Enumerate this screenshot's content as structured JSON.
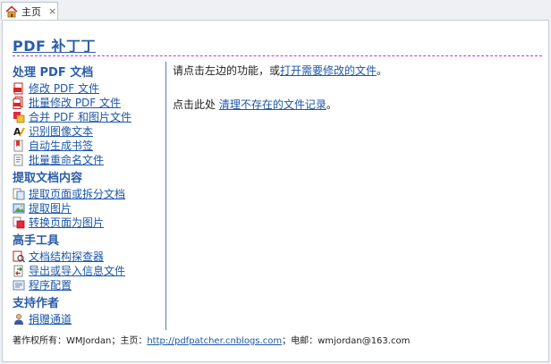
{
  "tab": {
    "label": "主页",
    "close": "×"
  },
  "title": "PDF 补丁丁",
  "sections": [
    {
      "heading": "处理 PDF 文档",
      "items": [
        {
          "label": "修改 PDF 文件",
          "icon": "pdf-edit-icon"
        },
        {
          "label": "批量修改 PDF 文件",
          "icon": "pdf-batch-icon"
        },
        {
          "label": "合并 PDF 和图片文件",
          "icon": "merge-icon"
        },
        {
          "label": "识别图像文本",
          "icon": "ocr-icon"
        },
        {
          "label": "自动生成书签",
          "icon": "bookmark-icon"
        },
        {
          "label": "批量重命名文件",
          "icon": "rename-icon"
        }
      ]
    },
    {
      "heading": "提取文档内容",
      "items": [
        {
          "label": "提取页面或拆分文档",
          "icon": "extract-pages-icon"
        },
        {
          "label": "提取图片",
          "icon": "extract-images-icon"
        },
        {
          "label": "转换页面为图片",
          "icon": "render-pages-icon"
        }
      ]
    },
    {
      "heading": "高手工具",
      "items": [
        {
          "label": "文档结构探查器",
          "icon": "inspector-icon"
        },
        {
          "label": "导出或导入信息文件",
          "icon": "export-import-icon"
        },
        {
          "label": "程序配置",
          "icon": "config-icon"
        }
      ]
    },
    {
      "heading": "支持作者",
      "items": [
        {
          "label": "捐赠通道",
          "icon": "donate-person-icon"
        }
      ]
    }
  ],
  "main": {
    "line1_prefix": "请点击左边的功能，或",
    "line1_link": "打开需要修改的文件",
    "line1_suffix": "。",
    "line2_prefix": "点击此处 ",
    "line2_link": "清理不存在的文件记录",
    "line2_suffix": "。"
  },
  "footer": {
    "prefix": "著作权所有：WMJordan；主页：",
    "link": "http://pdfpatcher.cnblogs.com",
    "suffix": "；电邮：wmjordan@163.com"
  },
  "colors": {
    "accent": "#2a5ca8",
    "link": "#1d57a8",
    "title_rule": "#cc33cc",
    "divider": "#5577bb"
  }
}
